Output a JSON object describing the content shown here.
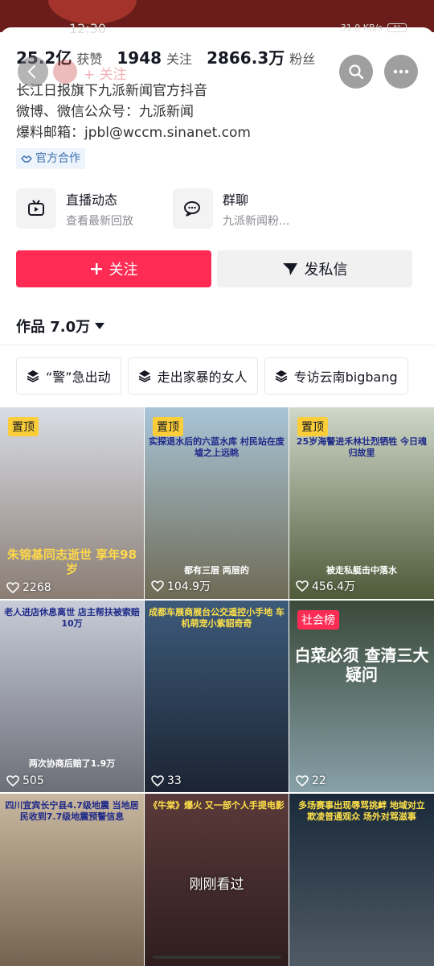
{
  "status_bar": {
    "time": "12:30",
    "network": "31.0 KB/s",
    "battery": "84"
  },
  "header": {
    "ghost_follow": "+ 关注"
  },
  "stats": [
    {
      "num": "25.2亿",
      "label": "获赞"
    },
    {
      "num": "1948",
      "label": "关注"
    },
    {
      "num": "2866.3万",
      "label": "粉丝"
    }
  ],
  "bio": {
    "line1": "长江日报旗下九派新闻官方抖音",
    "line2": "微博、微信公众号：九派新闻",
    "line3": "爆料邮箱：jpbl@wccm.sinanet.com"
  },
  "official_tag": "官方合作",
  "entries": {
    "live": {
      "title": "直播动态",
      "sub": "查看最新回放"
    },
    "group": {
      "title": "群聊",
      "sub": "九派新闻粉..."
    }
  },
  "actions": {
    "follow": "关注",
    "message": "发私信"
  },
  "works_label": "作品 7.0万",
  "collections": [
    "“警”急出动",
    "走出家暴的女人",
    "专访云南bigbang"
  ],
  "videos": [
    {
      "badge": "置顶",
      "likes": "2268",
      "cap_top": "",
      "cap_bottom": "朱镕基同志逝世 享年98岁",
      "colors": [
        "#d9dde6",
        "#8a7d74"
      ]
    },
    {
      "badge": "置顶",
      "likes": "104.9万",
      "cap_top": "实探退水后的六蓝水库 村民站在废墟之上远眺",
      "cap_bottom": "都有三层 两层的",
      "colors": [
        "#a9c5d8",
        "#6f6a55"
      ]
    },
    {
      "badge": "置顶",
      "likes": "456.4万",
      "cap_top": "25岁海警进禾林壮烈牺牲 今日魂归故里",
      "cap_bottom": "被走私艇击中落水",
      "colors": [
        "#cfd8c9",
        "#4f5a3a"
      ]
    },
    {
      "badge": "",
      "likes": "505",
      "cap_top": "老人进店休息离世 店主帮扶被索赔10万",
      "cap_bottom": "两次协商后赔了1.9万",
      "colors": [
        "#c7ccd8",
        "#6d6f78"
      ]
    },
    {
      "badge": "",
      "likes": "33",
      "cap_top": "成都车展商展台公交遥控小手地 车机萌宠小紫貂奇奇",
      "cap_bottom": "",
      "colors": [
        "#3d5a7a",
        "#1c2433"
      ]
    },
    {
      "badge": "社会榜",
      "likes": "22",
      "cap_top": "白菜必须 查清三大疑问",
      "cap_bottom": "",
      "colors": [
        "#3a4a3a",
        "#87a0a8"
      ]
    },
    {
      "badge": "",
      "likes": "",
      "cap_top": "四川宜宾长宁县4.7级地震 当地居民收到7.7级地震预警信息",
      "cap_bottom": "",
      "colors": [
        "#c9b8a0",
        "#6a5a48"
      ]
    },
    {
      "badge": "",
      "likes": "",
      "cap_top": "《牛棠》爆火 又一部个人手提电影",
      "cap_bottom": "",
      "recent": "刚刚看过",
      "colors": [
        "#5a3a3a",
        "#2a1a1a"
      ]
    },
    {
      "badge": "",
      "likes": "",
      "cap_top": "多场赛事出现辱骂挑衅 地域对立 欺凌普通观众 场外对骂滋事",
      "cap_bottom": "",
      "colors": [
        "#1a2a3a",
        "#55606a"
      ]
    }
  ]
}
